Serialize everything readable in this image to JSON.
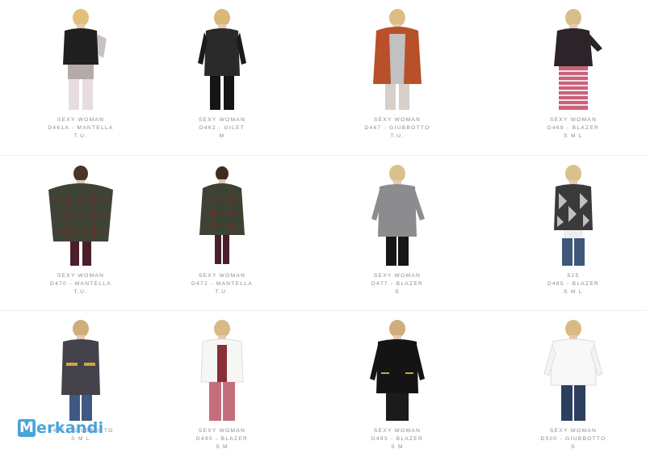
{
  "products": [
    {
      "brand": "SEXY WOMAN",
      "code": "D461A - MANTELLA",
      "sizes": "T.U."
    },
    {
      "brand": "SEXY WOMAN",
      "code": "D462 - GILET",
      "sizes": "M"
    },
    {
      "brand": "SEXY WOMAN",
      "code": "D467 - GIUBBOTTO",
      "sizes": "T.U."
    },
    {
      "brand": "SEXY WOMAN",
      "code": "D469 - BLAZER",
      "sizes": "S M L"
    },
    {
      "brand": "SEXY WOMAN",
      "code": "D470 - MANTELLA",
      "sizes": "T.U."
    },
    {
      "brand": "SEXY WOMAN",
      "code": "D472 - MANTELLA",
      "sizes": "T.U."
    },
    {
      "brand": "SEXY WOMAN",
      "code": "D477 - BLAZER",
      "sizes": "S"
    },
    {
      "brand": "525",
      "code": "D485 - BLAZER",
      "sizes": "S M L"
    },
    {
      "brand": "",
      "code": "D487 - GIUBBOTTO",
      "sizes": "S M L"
    },
    {
      "brand": "SEXY WOMAN",
      "code": "D490 - BLAZER",
      "sizes": "S M"
    },
    {
      "brand": "SEXY WOMAN",
      "code": "D493 - BLAZER",
      "sizes": "S M"
    },
    {
      "brand": "SEXY WOMAN",
      "code": "D500 - GIUBBOTTO",
      "sizes": "S"
    }
  ],
  "watermark": {
    "text": "Merkandi",
    "color": "#4aa3d8"
  }
}
